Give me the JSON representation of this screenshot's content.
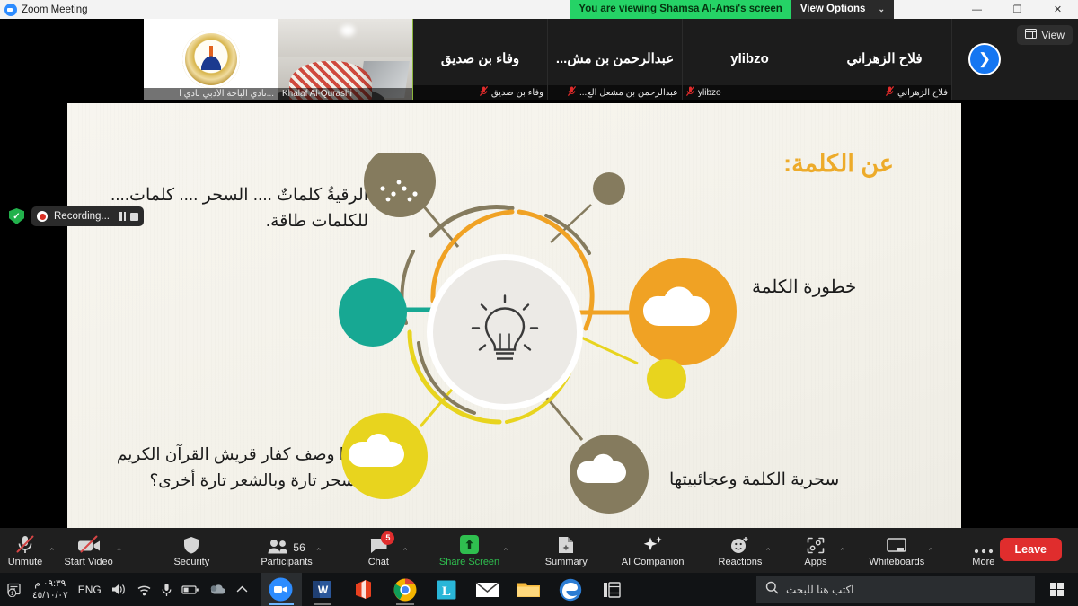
{
  "window": {
    "app_icon": "zoom-logo-icon",
    "title": "Zoom Meeting",
    "share_banner": "You are viewing Shamsa Al-Ansi's screen",
    "view_options_label": "View Options",
    "view_options_caret": "⌄",
    "minimize": "—",
    "restore": "❐",
    "close": "✕"
  },
  "recording": {
    "shield_icon": "encryption-shield-icon",
    "shield_glyph": "✓",
    "status_text": "Recording...",
    "pause_icon": "pause-icon",
    "stop_icon": "stop-icon"
  },
  "filmstrip": {
    "view_button_label": "View",
    "view_button_icon": "grid-view-icon",
    "next_page_icon": "chevron-right-icon",
    "next_page_glyph": "❯",
    "mic_muted_glyph": "🎤",
    "participants": [
      {
        "display_name": "",
        "caption": "...نادي الباحة الأدبي نادي ا",
        "type": "avatar",
        "muted": false,
        "active": false,
        "rtl": true
      },
      {
        "display_name": "",
        "caption": "Khalaf Al-Qurashi",
        "type": "video",
        "muted": false,
        "active": true,
        "rtl": false
      },
      {
        "display_name": "وفاء بن صديق",
        "caption": "وفاء بن صديق",
        "type": "name",
        "muted": true,
        "active": false,
        "rtl": true
      },
      {
        "display_name": "عبدالرحمن بن مش...",
        "caption": "عبدالرحمن بن مشعل الع...",
        "type": "name",
        "muted": true,
        "active": false,
        "rtl": true
      },
      {
        "display_name": "ylibzo",
        "caption": "ylibzo",
        "type": "name",
        "muted": true,
        "active": false,
        "rtl": false
      },
      {
        "display_name": "فلاح الزهراني",
        "caption": "فلاح الزهراني",
        "type": "name",
        "muted": true,
        "active": false,
        "rtl": true
      }
    ]
  },
  "slide": {
    "title": "عن الكلمة:",
    "text_top_left": "الرقيةُ كلماتٌ .... السحر .... كلمات.... للكلمات طاقة.",
    "text_bottom_left": "لماذا وصف كفار قريش القرآن الكريم بالسحر تارة وبالشعر تارة أخرى؟",
    "label_right_top": "خطورة الكلمة",
    "label_right_bottom": "سحرية الكلمة وعجائبيتها",
    "center_icon": "lightbulb-icon",
    "colors": {
      "title": "#edab2a",
      "node_orange": "#f0a224",
      "node_yellow": "#e8d41e",
      "node_teal": "#17a893",
      "node_brown": "#857b5e",
      "background": "#f5f3ec"
    }
  },
  "annotate": {
    "pen_icon": "pen-annotate-icon",
    "pen_color": "#3fa95b"
  },
  "toolbar": {
    "items": [
      {
        "label": "Unmute",
        "icon": "microphone-muted-icon",
        "caret": true,
        "green": false,
        "badge": null,
        "count": null
      },
      {
        "label": "Start Video",
        "icon": "camera-off-icon",
        "caret": true,
        "green": false,
        "badge": null,
        "count": null
      },
      {
        "label": "Security",
        "icon": "shield-icon",
        "caret": false,
        "green": false,
        "badge": null,
        "count": null
      },
      {
        "label": "Participants",
        "icon": "people-icon",
        "caret": true,
        "green": false,
        "badge": null,
        "count": "56"
      },
      {
        "label": "Chat",
        "icon": "chat-bubble-icon",
        "caret": true,
        "green": false,
        "badge": "5",
        "count": null
      },
      {
        "label": "Share Screen",
        "icon": "share-screen-icon",
        "caret": true,
        "green": true,
        "badge": null,
        "count": null
      },
      {
        "label": "Summary",
        "icon": "summary-doc-icon",
        "caret": false,
        "green": false,
        "badge": null,
        "count": null
      },
      {
        "label": "AI Companion",
        "icon": "ai-sparkle-icon",
        "caret": false,
        "green": false,
        "badge": null,
        "count": null
      },
      {
        "label": "Reactions",
        "icon": "reactions-smiley-icon",
        "caret": true,
        "green": false,
        "badge": null,
        "count": null
      },
      {
        "label": "Apps",
        "icon": "apps-icon",
        "caret": true,
        "green": false,
        "badge": null,
        "count": null
      },
      {
        "label": "Whiteboards",
        "icon": "whiteboard-icon",
        "caret": true,
        "green": false,
        "badge": null,
        "count": null
      },
      {
        "label": "More",
        "icon": "more-dots-icon",
        "caret": false,
        "green": false,
        "badge": null,
        "count": null
      }
    ],
    "leave_label": "Leave",
    "leave_color": "#e02d2d"
  },
  "taskbar": {
    "clock_time": "٠٩:٣٩ م",
    "clock_date": "٤٥/١٠/٠٧",
    "language": "ENG",
    "tray_icons": [
      "volume-icon",
      "wifi-icon",
      "microphone-icon",
      "battery-icon",
      "onedrive-icon",
      "show-hidden-icons-icon"
    ],
    "notification_icon": "action-center-icon",
    "notification_count": "1",
    "apps": [
      {
        "name": "zoom-taskbar-icon",
        "label": "zoom",
        "state": "active"
      },
      {
        "name": "word-taskbar-icon",
        "label": "W",
        "state": "open"
      },
      {
        "name": "office-taskbar-icon",
        "label": "O",
        "state": "idle"
      },
      {
        "name": "chrome-taskbar-icon",
        "label": "",
        "state": "open"
      },
      {
        "name": "lightshot-taskbar-icon",
        "label": "L",
        "state": "idle"
      },
      {
        "name": "mail-taskbar-icon",
        "label": "",
        "state": "idle"
      },
      {
        "name": "file-explorer-taskbar-icon",
        "label": "",
        "state": "idle"
      },
      {
        "name": "edge-taskbar-icon",
        "label": "e",
        "state": "idle"
      },
      {
        "name": "movie-maker-taskbar-icon",
        "label": "",
        "state": "idle"
      }
    ],
    "search_placeholder": "اكتب هنا للبحث",
    "search_icon": "search-icon",
    "start_icon": "windows-start-icon"
  }
}
